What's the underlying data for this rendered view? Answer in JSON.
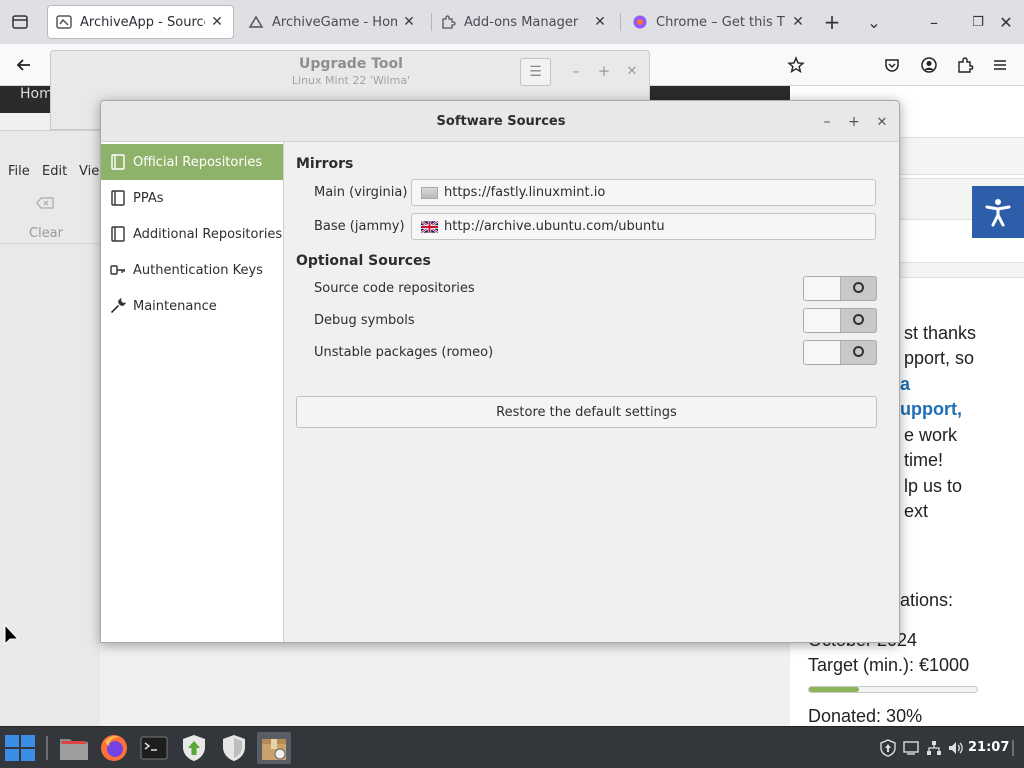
{
  "browser": {
    "tabs": [
      {
        "title": "ArchiveApp - Source o",
        "active": true
      },
      {
        "title": "ArchiveGame - Home",
        "active": false
      },
      {
        "title": "Add-ons Manager",
        "active": false
      },
      {
        "title": "Chrome – Get this The",
        "active": false
      }
    ],
    "new_tab_symbol": "+",
    "tab_list_symbol": "⌄",
    "window_controls": {
      "minimize": "–",
      "restore": "❐",
      "close": "✕"
    },
    "close_tab_symbol": "✕"
  },
  "webpage": {
    "nav_fragment": "Hom",
    "donation_text_lines": [
      "st thanks",
      "pport, so",
      "a",
      "upport,",
      "e work",
      "time!",
      "lp us to",
      "ext"
    ],
    "donations_label": "ations:",
    "month": "October 2024",
    "target_label": "Target (min.): €1000",
    "donated_label": "Donated: 30%",
    "donated_fraction": 0.3,
    "accent_color": "#2e5da9"
  },
  "upgrade_tool": {
    "title": "Upgrade Tool",
    "subtitle": "Linux Mint 22 'Wilma'",
    "menu_symbol": "☰",
    "controls": {
      "minimize": "–",
      "maximize": "+",
      "close": "✕"
    }
  },
  "left_app": {
    "menu": [
      "File",
      "Edit",
      "Vie"
    ],
    "clear_label": "Clear"
  },
  "software_sources": {
    "title": "Software Sources",
    "controls": {
      "minimize": "–",
      "maximize": "+",
      "close": "✕"
    },
    "sidebar": [
      {
        "label": "Official Repositories",
        "icon": "book-icon",
        "active": true
      },
      {
        "label": "PPAs",
        "icon": "book-icon",
        "active": false
      },
      {
        "label": "Additional Repositories",
        "icon": "book-icon",
        "active": false
      },
      {
        "label": "Authentication Keys",
        "icon": "key-icon",
        "active": false
      },
      {
        "label": "Maintenance",
        "icon": "wrench-icon",
        "active": false
      }
    ],
    "mirrors_heading": "Mirrors",
    "mirrors": [
      {
        "label": "Main (virginia)",
        "url": "https://fastly.linuxmint.io",
        "flag": "grey-flag"
      },
      {
        "label": "Base (jammy)",
        "url": "http://archive.ubuntu.com/ubuntu",
        "flag": "uk-flag"
      }
    ],
    "optional_heading": "Optional Sources",
    "optional": [
      {
        "label": "Source code repositories",
        "enabled": false
      },
      {
        "label": "Debug symbols",
        "enabled": false
      },
      {
        "label": "Unstable packages (romeo)",
        "enabled": false
      }
    ],
    "restore_label": "Restore the default settings",
    "accent_color": "#8fb26a"
  },
  "taskbar": {
    "clock": "21:07"
  }
}
